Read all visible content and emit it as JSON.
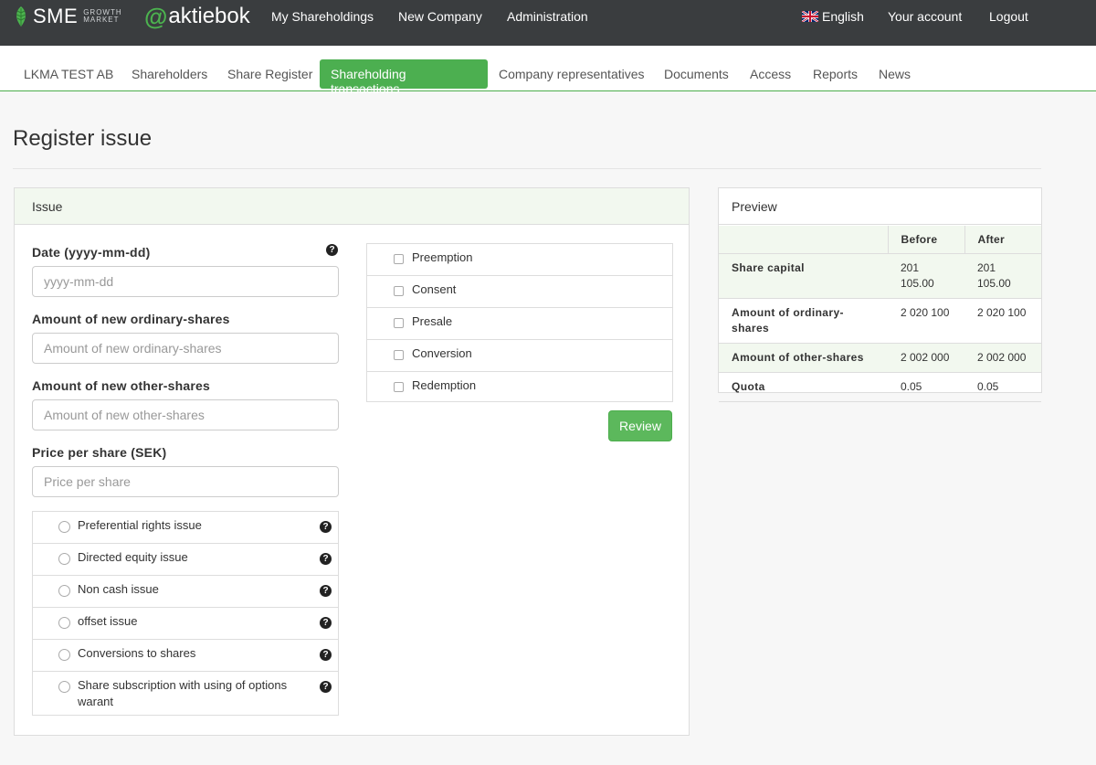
{
  "topbar": {
    "sme_logo": "SME",
    "sme_growth": "GROWTH",
    "sme_market": "MARKET",
    "aktiebok_logo": "aktiebok",
    "nav": [
      "My Shareholdings",
      "New Company",
      "Administration"
    ],
    "language": "English",
    "your_account": "Your account",
    "logout": "Logout"
  },
  "subnav": {
    "tabs": [
      "LKMA TEST AB",
      "Shareholders",
      "Share Register",
      "Shareholding transactions",
      "Company representatives",
      "Documents",
      "Access",
      "Reports",
      "News"
    ],
    "active_index": 3
  },
  "page": {
    "title": "Register issue"
  },
  "issue": {
    "heading": "Issue",
    "date_label": "Date (yyyy-mm-dd)",
    "date_placeholder": "yyyy-mm-dd",
    "ordinary_label": "Amount of new ordinary-shares",
    "ordinary_placeholder": "Amount of new ordinary-shares",
    "other_label": "Amount of new other-shares",
    "other_placeholder": "Amount of new other-shares",
    "price_label": "Price per share (SEK)",
    "price_placeholder": "Price per share",
    "issue_types": [
      "Preferential rights issue",
      "Directed equity issue",
      "Non cash issue",
      "offset issue",
      "Conversions to shares",
      "Share subscription with using of options warant"
    ],
    "clauses": [
      "Preemption",
      "Consent",
      "Presale",
      "Conversion",
      "Redemption"
    ],
    "review_button": "Review"
  },
  "preview": {
    "heading": "Preview",
    "columns": [
      "",
      "Before",
      "After"
    ],
    "rows": [
      {
        "label": "Share capital",
        "before": "201 105.00",
        "after": "201 105.00"
      },
      {
        "label": "Amount of ordinary-shares",
        "before": "2 020 100",
        "after": "2 020 100"
      },
      {
        "label": "Amount of other-shares",
        "before": "2 002 000",
        "after": "2 002 000"
      },
      {
        "label": "Quota",
        "before": "0.05",
        "after": "0.05"
      }
    ]
  },
  "colors": {
    "topbar_bg": "#3a3d3f",
    "accent_green": "#4caf50",
    "panel_heading_bg": "#f2f8ef"
  }
}
